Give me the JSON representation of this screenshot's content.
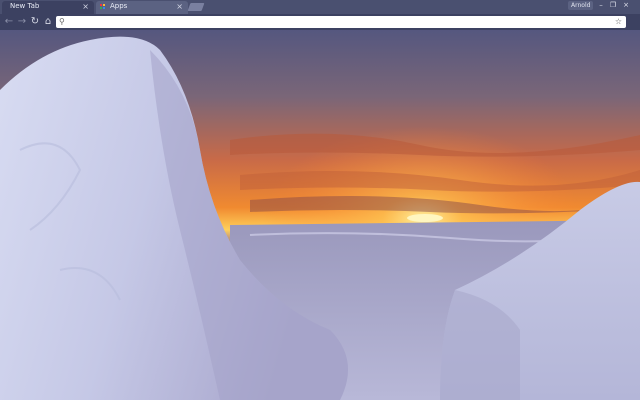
{
  "browser": {
    "tabs": [
      {
        "label": "New Tab",
        "active": true
      },
      {
        "label": "Apps",
        "active": false
      }
    ],
    "close_glyph": "×",
    "profile_name": "Arnold",
    "window_controls": {
      "minimize": "–",
      "restore": "❐",
      "close": "×"
    },
    "nav": {
      "back": "←",
      "forward": "→",
      "reload": "↻",
      "home": "⌂"
    },
    "omnibox": {
      "value": "",
      "search_icon": "⚲",
      "star_icon": "☆"
    }
  },
  "theme": {
    "scene": "arctic sunset over snow",
    "colors": {
      "sky_top": "#5a5a8a",
      "sunset": "#f08a30",
      "sun": "#ffe070",
      "snow": "#c8cce8",
      "chrome": "#3c4161"
    }
  }
}
